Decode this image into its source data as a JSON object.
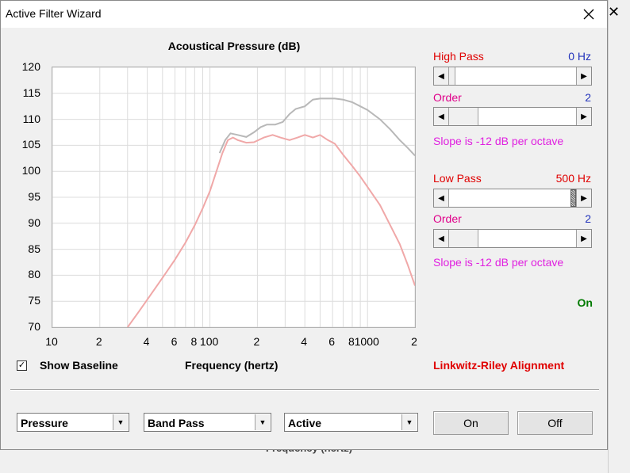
{
  "window": {
    "title": "Active Filter Wizard"
  },
  "plot": {
    "title": "Acoustical Pressure (dB)",
    "x_axis_label": "Frequency (hertz)",
    "y_ticks": [
      "120",
      "115",
      "110",
      "105",
      "100",
      "95",
      "90",
      "85",
      "80",
      "75",
      "70"
    ],
    "x_ticks": [
      "10",
      "2",
      "4",
      "6",
      "8",
      "100",
      "2",
      "4",
      "6",
      "8",
      "1000",
      "2"
    ]
  },
  "baseline": {
    "label": "Show Baseline",
    "checked": true
  },
  "high_pass": {
    "label": "High Pass",
    "value": "0 Hz",
    "position_fraction": 0.0,
    "order_label": "Order",
    "order_value": "2",
    "order_position_fraction": 0.0,
    "slope_text": "Slope is -12 dB per octave"
  },
  "low_pass": {
    "label": "Low Pass",
    "value": "500 Hz",
    "position_fraction": 0.5,
    "order_label": "Order",
    "order_value": "2",
    "order_position_fraction": 0.0,
    "slope_text": "Slope is -12 dB per octave"
  },
  "status": "On",
  "alignment": "Linkwitz-Riley Alignment",
  "controls": {
    "mode_select": "Pressure",
    "filter_select": "Band Pass",
    "type_select": "Active",
    "on_button": "On",
    "off_button": "Off"
  },
  "underlay": {
    "partial_text": "Frequency (hertz)"
  },
  "colors": {
    "baseline_curve": "#b8b8b8",
    "filtered_curve": "#f0a8a8",
    "on_status": "#007a00"
  },
  "chart_data": {
    "type": "line",
    "title": "Acoustical Pressure (dB)",
    "xlabel": "Frequency (hertz)",
    "ylabel": "",
    "x_scale": "log",
    "xlim": [
      10,
      2000
    ],
    "ylim": [
      70,
      120
    ],
    "grid": true,
    "series": [
      {
        "color": "#b8b8b8",
        "x": [
          115,
          125,
          135,
          150,
          170,
          190,
          210,
          230,
          260,
          290,
          320,
          350,
          400,
          450,
          500,
          560,
          620,
          700,
          800,
          900,
          1000,
          1200,
          1400,
          1600,
          1800,
          2000
        ],
        "y": [
          103.5,
          106,
          107.3,
          107,
          106.6,
          107.5,
          108.5,
          109,
          109,
          109.5,
          111,
          112,
          112.5,
          113.8,
          114,
          114,
          114,
          113.8,
          113.3,
          112.5,
          111.8,
          110,
          108,
          106,
          104.5,
          103
        ]
      },
      {
        "color": "#f0a8a8",
        "x": [
          30,
          35,
          40,
          50,
          60,
          70,
          80,
          90,
          100,
          110,
          120,
          130,
          140,
          150,
          170,
          190,
          220,
          250,
          280,
          320,
          360,
          400,
          450,
          500,
          560,
          620,
          700,
          800,
          900,
          1000,
          1200,
          1400,
          1600,
          1800,
          2000
        ],
        "y": [
          70,
          72.8,
          75.3,
          79.5,
          83,
          86.3,
          89.6,
          92.9,
          96.2,
          100,
          103.5,
          106,
          106.5,
          106,
          105.5,
          105.6,
          106.5,
          107,
          106.5,
          106,
          106.5,
          107,
          106.5,
          107,
          106,
          105.3,
          103.2,
          101,
          99,
          97,
          93.5,
          89.5,
          86,
          82,
          78
        ]
      }
    ]
  }
}
